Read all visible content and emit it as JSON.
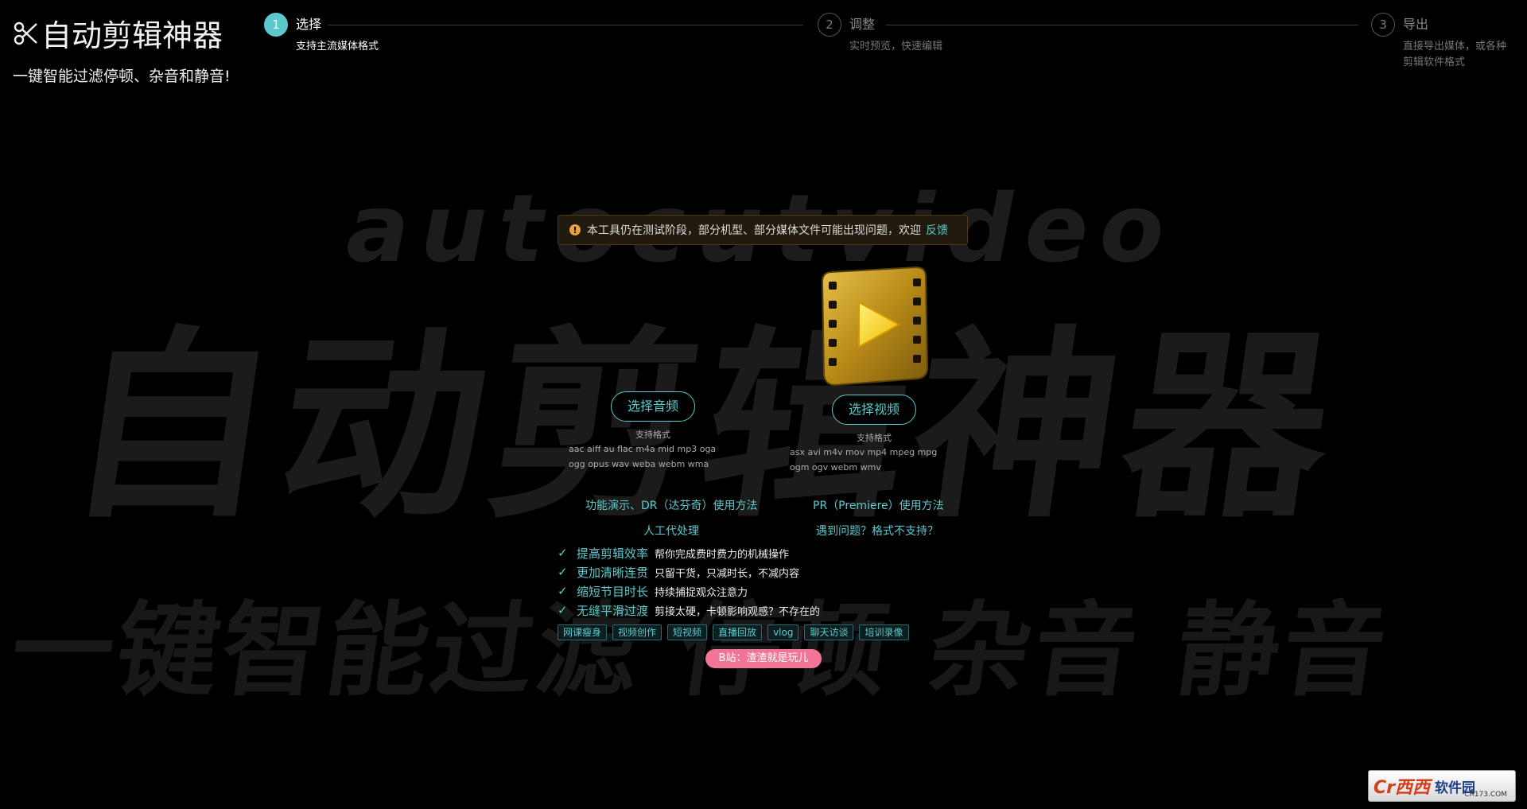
{
  "background": {
    "word1": "autocutvideo",
    "word2": "自动剪辑神器",
    "word3": "一键智能过滤 停顿 杂音 静音"
  },
  "brand": {
    "title": "自动剪辑神器",
    "subtitle": "一键智能过滤停顿、杂音和静音!",
    "icon": "scissors-icon"
  },
  "steps": [
    {
      "num": "1",
      "title": "选择",
      "desc": "支持主流媒体格式",
      "active": true
    },
    {
      "num": "2",
      "title": "调整",
      "desc": "实时预览，快速编辑",
      "active": false
    },
    {
      "num": "3",
      "title": "导出",
      "desc1": "直接导出媒体，或各种",
      "desc2": "剪辑软件格式",
      "active": false
    }
  ],
  "alert": {
    "text": "本工具仍在测试阶段，部分机型、部分媒体文件可能出现问题，欢迎",
    "link": "反馈"
  },
  "audio": {
    "button": "选择音频",
    "formats_label": "支持格式",
    "formats_line1": "aac  aiff  au  flac  m4a  mid  mp3  oga",
    "formats_line2": "ogg opus wav weba webm wma"
  },
  "video": {
    "button": "选择视频",
    "formats_label": "支持格式",
    "formats_line1": "asx  avi  m4v  mov  mp4  mpeg  mpg",
    "formats_line2": "ogm ogv webm wmv"
  },
  "links": {
    "demo_dr": "功能演示、DR（达芬奇）使用方法",
    "pr": "PR（Premiere）使用方法",
    "manual": "人工代处理",
    "problem": "遇到问题？格式不支持？"
  },
  "features": [
    {
      "title": "提高剪辑效率",
      "desc": "帮你完成费时费力的机械操作"
    },
    {
      "title": "更加清晰连贯",
      "desc": "只留干货，只减时长，不减内容"
    },
    {
      "title": "缩短节目时长",
      "desc": "持续捕捉观众注意力"
    },
    {
      "title": "无缝平滑过渡",
      "desc": "剪接太硬，卡顿影响观感？不存在的"
    }
  ],
  "tags": [
    "网课瘦身",
    "视频创作",
    "短视频",
    "直播回放",
    "vlog",
    "聊天访谈",
    "培训录像"
  ],
  "bilibili": "B站：渣渣就是玩儿",
  "watermark": {
    "logo": "Cr西西",
    "text": "软件园",
    "url": "CR173.COM"
  },
  "colors": {
    "accent": "#5cc9cc",
    "pink": "#f07596",
    "warning": "#e6a23c"
  }
}
